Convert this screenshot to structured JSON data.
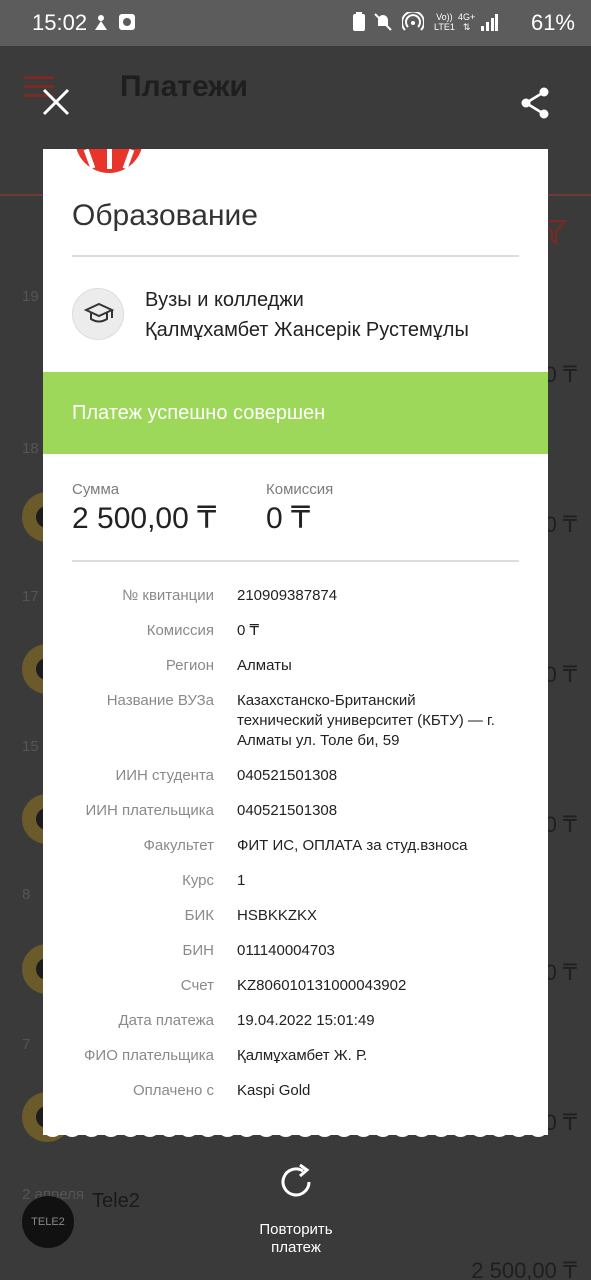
{
  "status_bar": {
    "time": "15:02",
    "battery": "61%",
    "net_top": "Vo))",
    "net_bottom": "LTE1",
    "gen": "4G+"
  },
  "background": {
    "title": "Платежи",
    "dates": [
      "19",
      "18",
      "17",
      "15",
      "8",
      "7",
      "2 апреля"
    ],
    "amount_fragment": "0 ₸",
    "last_item_name": "Tele2",
    "last_item_amount": "2 500,00 ₸",
    "tele2_logo_text": "TELE2"
  },
  "receipt": {
    "category": "Образование",
    "provider_type": "Вузы и колледжи",
    "provider_payee": "Қалмұхамбет Жансерік Рустемұлы",
    "status_text": "Платеж успешно совершен",
    "sum_label": "Сумма",
    "sum_value": "2 500,00 ₸",
    "commission_label": "Комиссия",
    "commission_value": "0 ₸",
    "details": [
      {
        "label": "№ квитанции",
        "value": "210909387874"
      },
      {
        "label": "Комиссия",
        "value": "0 ₸"
      },
      {
        "label": "Регион",
        "value": "Алматы"
      },
      {
        "label": "Название ВУЗа",
        "value": "Казахстанско-Британский технический университет (КБТУ) — г. Алматы ул. Толе би, 59"
      },
      {
        "label": "ИИН студента",
        "value": "040521501308"
      },
      {
        "label": "ИИН плательщика",
        "value": "040521501308"
      },
      {
        "label": "Факультет",
        "value": "ФИТ ИС, ОПЛАТА за студ.взноса"
      },
      {
        "label": "Курс",
        "value": "1"
      },
      {
        "label": "БИК",
        "value": "HSBKKZKX"
      },
      {
        "label": "БИН",
        "value": "011140004703"
      },
      {
        "label": "Счет",
        "value": "KZ806010131000043902"
      },
      {
        "label": "Дата платежа",
        "value": "19.04.2022 15:01:49"
      },
      {
        "label": "ФИО плательщика",
        "value": "Қалмұхамбет Ж. Р."
      },
      {
        "label": "Оплачено с",
        "value": "Kaspi Gold"
      }
    ]
  },
  "actions": {
    "repeat_label": "Повторить платеж"
  },
  "colors": {
    "success": "#9ed85a",
    "accent": "#e8352b",
    "overlay": "#2f2f2f"
  }
}
